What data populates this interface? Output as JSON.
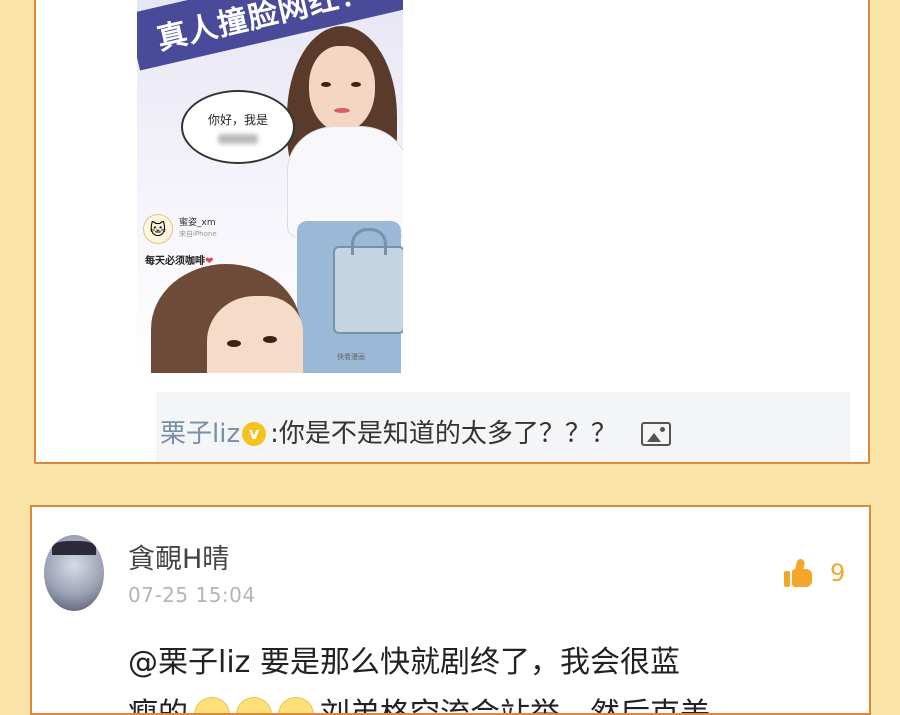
{
  "post": {
    "comic": {
      "banner_text": "真人撞脸网红！",
      "bubble_text": "你好，我是",
      "profile_name": "蜜姿_xm",
      "profile_sub": "来自iPhone",
      "caption": "每天必须咖啡",
      "watermark": "快看漫画"
    },
    "reply": {
      "username": "栗子liz",
      "badge": "v",
      "separator": ":",
      "text": "你是不是知道的太多了？？？"
    }
  },
  "comment": {
    "username": "貪靦H晴",
    "timestamp": "07-25 15:04",
    "likes": "9",
    "text_line1": "@栗子liz  要是那么快就剧终了，我会很蓝",
    "text_line2_start": "瘦的",
    "text_line2_end": "刘弟格空流会站举，然后克美"
  },
  "colors": {
    "background": "#f9e3a6",
    "card_border": "#d98a3a",
    "like_accent": "#f4a62a",
    "username_link": "#7a8ea8",
    "verified_badge": "#f4c321"
  },
  "icons": [
    "verified-badge-icon",
    "image-icon",
    "thumbs-up-icon"
  ]
}
